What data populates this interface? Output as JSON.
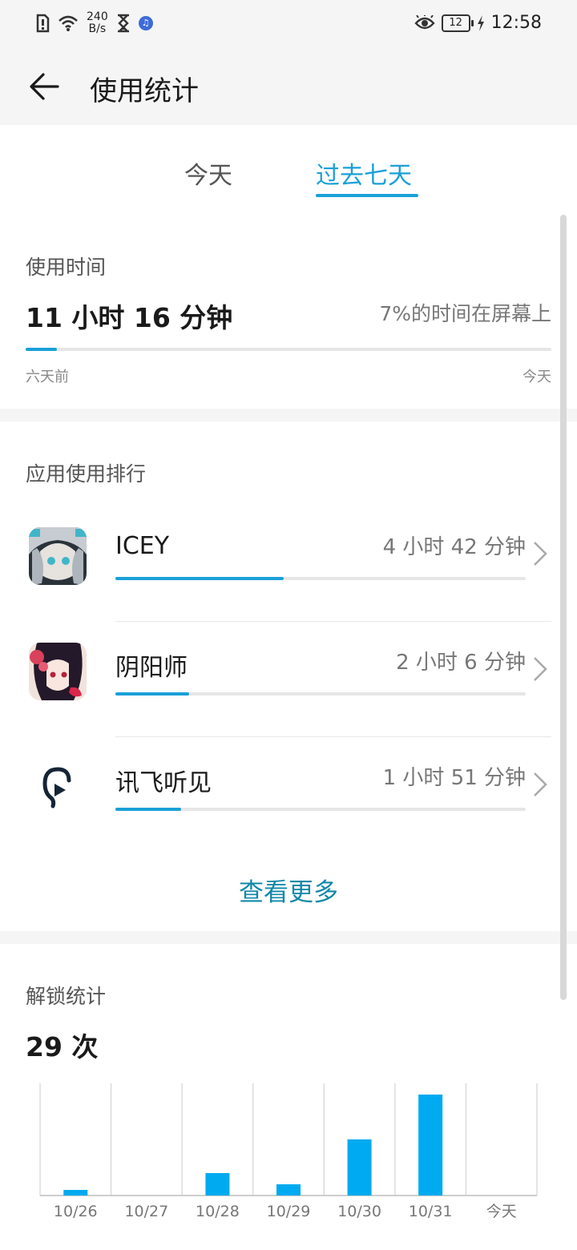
{
  "status_bar": {
    "net_speed_value": "240",
    "net_speed_unit": "B/s",
    "battery": "12",
    "time": "12:58"
  },
  "header": {
    "title": "使用统计"
  },
  "tabs": {
    "today": "今天",
    "week": "过去七天"
  },
  "usage": {
    "label": "使用时间",
    "total": "11 小时 16 分钟",
    "percent_text": "7%的时间在屏幕上",
    "progress": 0.06,
    "start_label": "六天前",
    "end_label": "今天"
  },
  "ranking": {
    "label": "应用使用排行",
    "apps": [
      {
        "name": "ICEY",
        "time": "4 小时 42 分钟",
        "fraction": 0.41
      },
      {
        "name": "阴阳师",
        "time": "2 小时 6 分钟",
        "fraction": 0.18
      },
      {
        "name": "讯飞听见",
        "time": "1 小时 51 分钟",
        "fraction": 0.16
      }
    ],
    "see_more": "查看更多"
  },
  "unlock": {
    "label": "解锁统计",
    "total": "29 次"
  },
  "chart_data": {
    "type": "bar",
    "categories": [
      "10/26",
      "10/27",
      "10/28",
      "10/29",
      "10/30",
      "10/31",
      "今天"
    ],
    "values": [
      1,
      0,
      4,
      2,
      10,
      18,
      0
    ],
    "ylim": [
      0,
      20
    ],
    "color": "#00aaf0"
  },
  "colors": {
    "accent": "#1aa0d8",
    "link": "#1188a8"
  }
}
